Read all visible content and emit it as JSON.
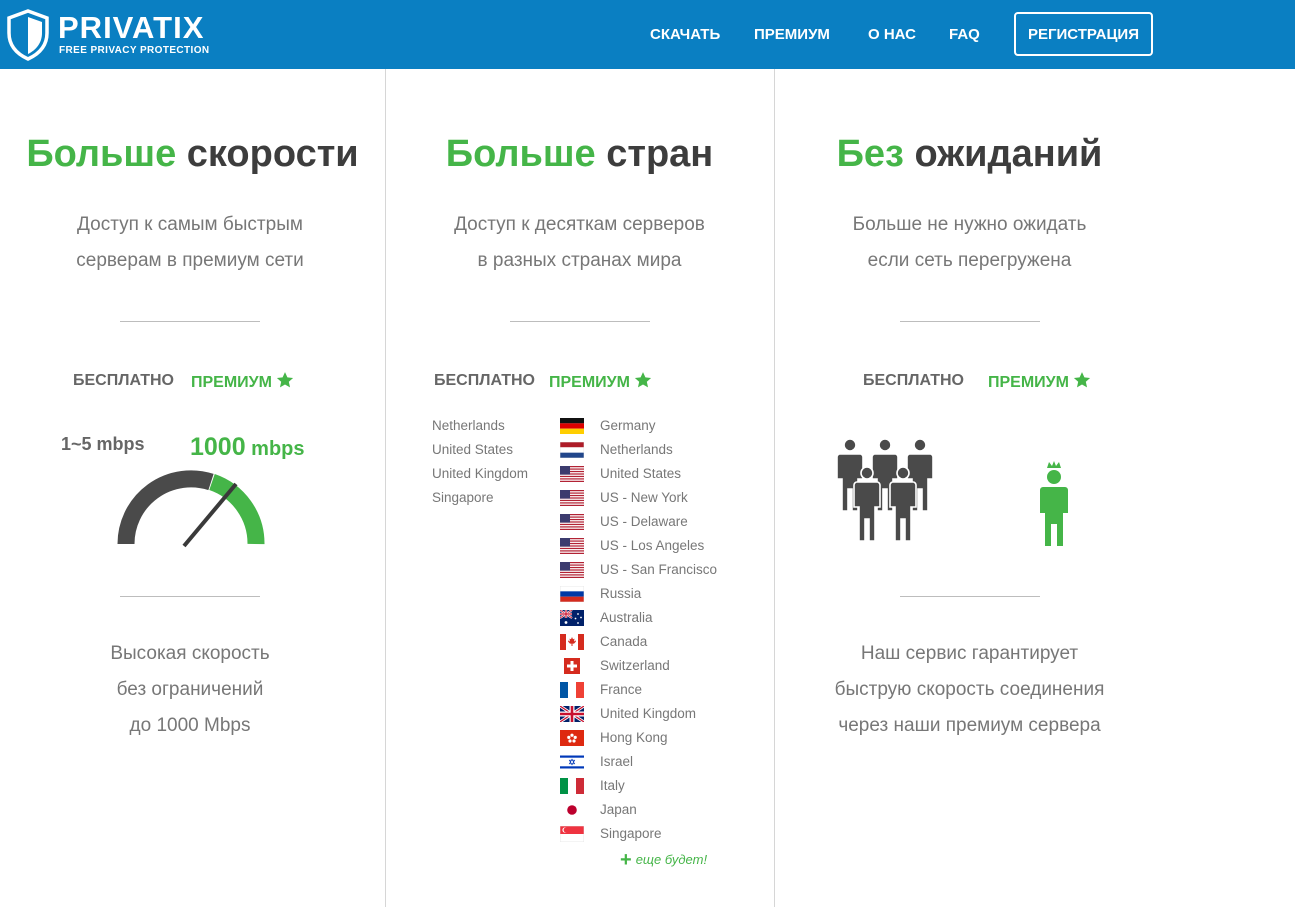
{
  "header": {
    "logo_name": "PRIVATIX",
    "logo_tagline": "FREE PRIVACY PROTECTION",
    "nav": [
      "СКАЧАТЬ",
      "ПРЕМИУМ",
      "О НАС",
      "FAQ"
    ],
    "register_label": "РЕГИСТРАЦИЯ",
    "bg_color": "#0a7fc2"
  },
  "accent_color": "#45b548",
  "columns": [
    {
      "title_accent": "Больше",
      "title_rest": " скорости",
      "desc_lines": [
        "Доступ к самым быстрым",
        "серверам в премиум сети"
      ],
      "free_label": "БЕСПЛАТНО",
      "premium_label": "ПРЕМИУМ",
      "free_speed": "1~5 mbps",
      "premium_speed_value": "1000",
      "premium_speed_unit": " mbps",
      "bottom_lines": [
        "Высокая скорость",
        "без ограничений",
        "до 1000 Mbps"
      ]
    },
    {
      "title_accent": "Больше",
      "title_rest": " стран",
      "desc_lines": [
        "Доступ к десяткам серверов",
        "в разных странах мира"
      ],
      "free_label": "БЕСПЛАТНО",
      "premium_label": "ПРЕМИУМ",
      "free_countries": [
        "Netherlands",
        "United States",
        "United Kingdom",
        "Singapore"
      ],
      "premium_countries": [
        {
          "name": "Germany",
          "flag": "de-flag"
        },
        {
          "name": "Netherlands",
          "flag": "nl-flag"
        },
        {
          "name": "United States",
          "flag": "us-flag"
        },
        {
          "name": "US - New York",
          "flag": "us-flag"
        },
        {
          "name": "US - Delaware",
          "flag": "us-flag"
        },
        {
          "name": "US - Los Angeles",
          "flag": "us-flag"
        },
        {
          "name": "US - San Francisco",
          "flag": "us-flag"
        },
        {
          "name": "Russia",
          "flag": "ru-flag"
        },
        {
          "name": "Australia",
          "flag": "au-flag"
        },
        {
          "name": "Canada",
          "flag": "ca-flag"
        },
        {
          "name": "Switzerland",
          "flag": "ch-flag"
        },
        {
          "name": "France",
          "flag": "fr-flag"
        },
        {
          "name": "United Kingdom",
          "flag": "gb-flag"
        },
        {
          "name": "Hong Kong",
          "flag": "hk-flag"
        },
        {
          "name": "Israel",
          "flag": "il-flag"
        },
        {
          "name": "Italy",
          "flag": "it-flag"
        },
        {
          "name": "Japan",
          "flag": "jp-flag"
        },
        {
          "name": "Singapore",
          "flag": "sg-flag"
        }
      ],
      "more_label": "еще будет!"
    },
    {
      "title_accent": "Без",
      "title_rest": " ожиданий",
      "desc_lines": [
        "Больше не нужно ожидать",
        "если сеть перегружена"
      ],
      "free_label": "БЕСПЛАТНО",
      "premium_label": "ПРЕМИУМ",
      "bottom_lines": [
        "Наш сервис гарантирует",
        "быструю скорость соединения",
        "через наши премиум сервера"
      ]
    }
  ]
}
